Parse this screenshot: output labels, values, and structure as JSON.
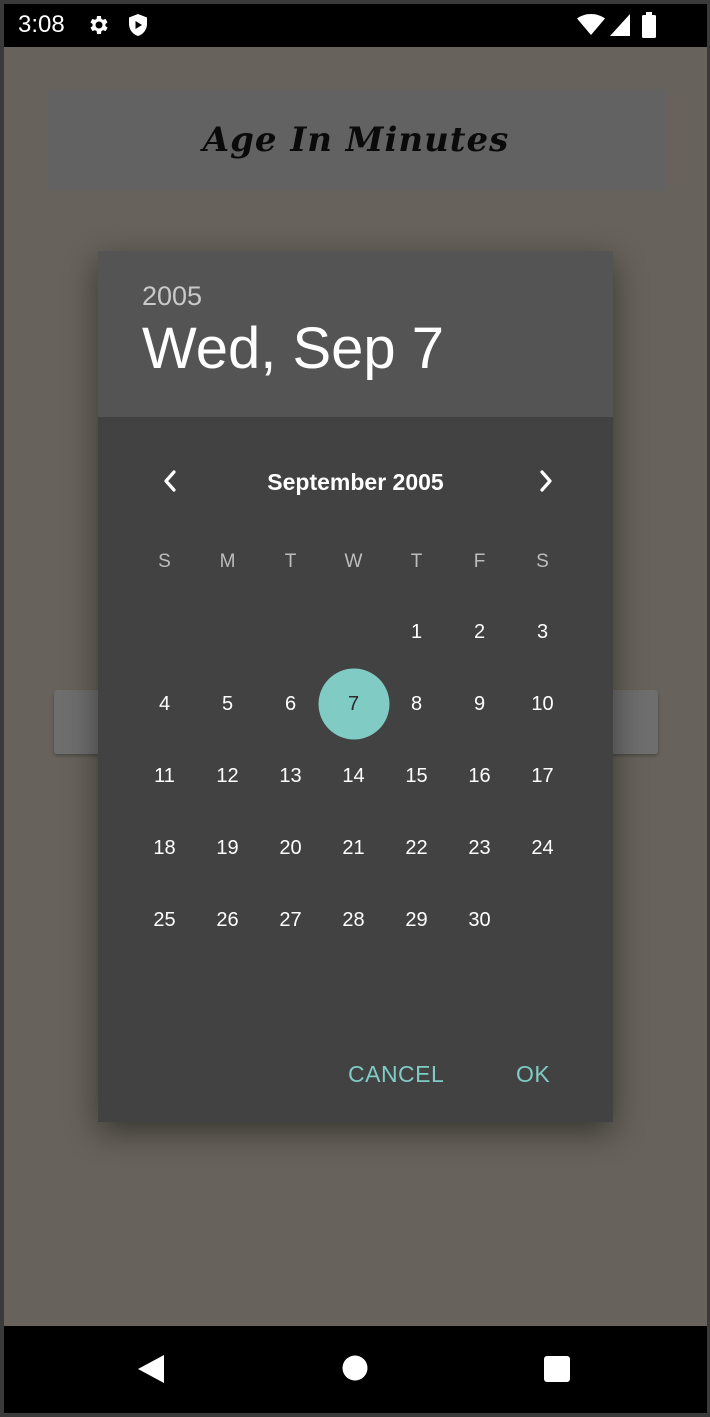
{
  "status_bar": {
    "time": "3:08",
    "icons": [
      "gear-icon",
      "shield-icon",
      "wifi-icon",
      "signal-icon",
      "battery-icon"
    ]
  },
  "app": {
    "title": "Age In Minutes"
  },
  "date_picker": {
    "header_year": "2005",
    "header_date": "Wed, Sep 7",
    "month_label": "September 2005",
    "weekdays": [
      "S",
      "M",
      "T",
      "W",
      "T",
      "F",
      "S"
    ],
    "days": [
      "",
      "",
      "",
      "",
      "1",
      "2",
      "3",
      "4",
      "5",
      "6",
      "7",
      "8",
      "9",
      "10",
      "11",
      "12",
      "13",
      "14",
      "15",
      "16",
      "17",
      "18",
      "19",
      "20",
      "21",
      "22",
      "23",
      "24",
      "25",
      "26",
      "27",
      "28",
      "29",
      "30",
      ""
    ],
    "selected_day": "7",
    "cancel_label": "CANCEL",
    "ok_label": "OK",
    "accent_color": "#80cbc4"
  },
  "nav_bar": {
    "icons": [
      "back-icon",
      "home-icon",
      "recents-icon"
    ]
  }
}
